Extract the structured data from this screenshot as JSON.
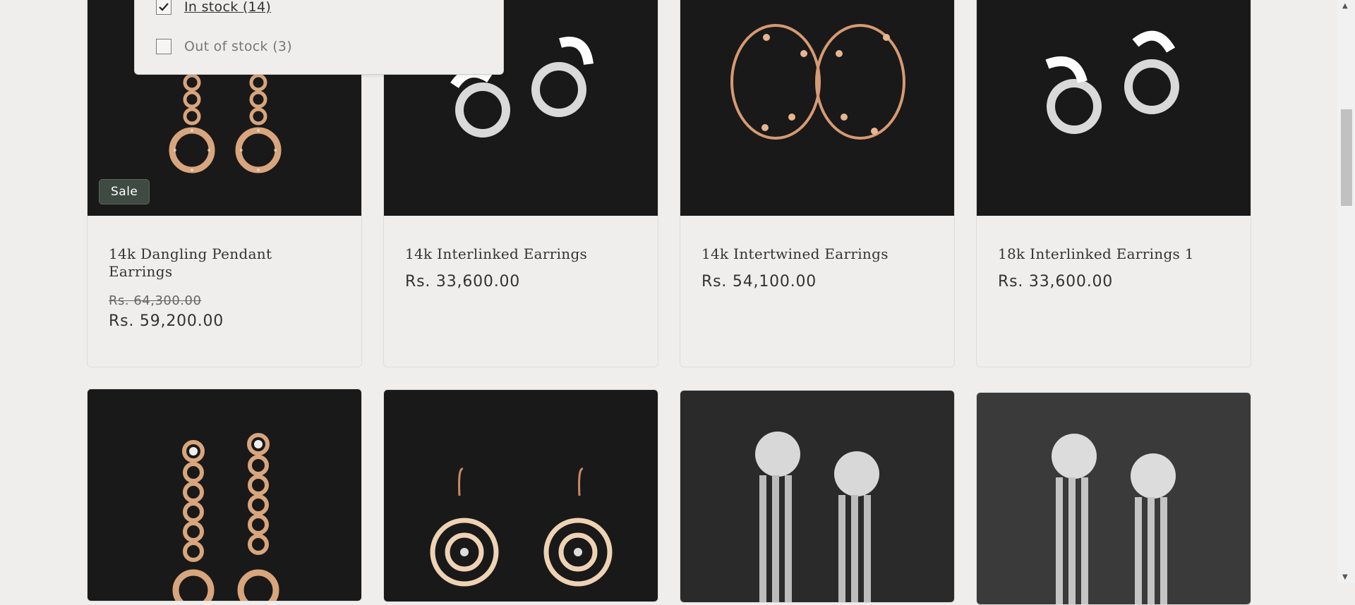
{
  "filter": {
    "options": [
      {
        "label": "In stock (14)",
        "checked": true
      },
      {
        "label": "Out of stock (3)",
        "checked": false
      }
    ]
  },
  "products": [
    {
      "title": "14k Dangling Pendant Earrings",
      "price_old": "Rs. 64,300.00",
      "price": "Rs. 59,200.00",
      "badge": "Sale"
    },
    {
      "title": "14k Interlinked Earrings",
      "price": "Rs. 33,600.00"
    },
    {
      "title": "14k Intertwined Earrings",
      "price": "Rs. 54,100.00"
    },
    {
      "title": "18k Interlinked Earrings 1",
      "price": "Rs. 33,600.00"
    }
  ],
  "colors": {
    "background": "#efeeec",
    "image_bg": "#191919",
    "badge_bg": "#3f4a42"
  }
}
